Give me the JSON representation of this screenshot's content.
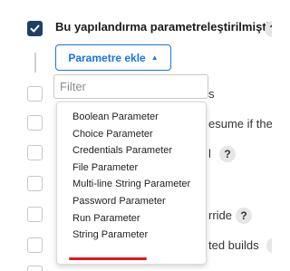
{
  "parameterized": {
    "checked": true,
    "label": "Bu yapılandırma parametreleştirilmiştir.",
    "help": "?"
  },
  "add_parameter": {
    "label": "Parametre ekle",
    "caret": "▲"
  },
  "filter": {
    "placeholder": "Filter"
  },
  "menu": {
    "items": [
      "Boolean Parameter",
      "Choice Parameter",
      "Credentials Parameter",
      "File Parameter",
      "Multi-line String Parameter",
      "Password Parameter",
      "Run Parameter",
      "String Parameter"
    ],
    "highlighted": "String Parameter"
  },
  "background_options": {
    "row1": "s",
    "row2": "esume if the",
    "row3": "l",
    "row3_help": "?",
    "row5": "rride",
    "row5_help": "?",
    "row6": "ted builds",
    "row6_help": "?"
  },
  "colors": {
    "accent": "#1a73e8",
    "checkbox": "#1f3f6b",
    "highlight_underline": "#e0181f"
  }
}
